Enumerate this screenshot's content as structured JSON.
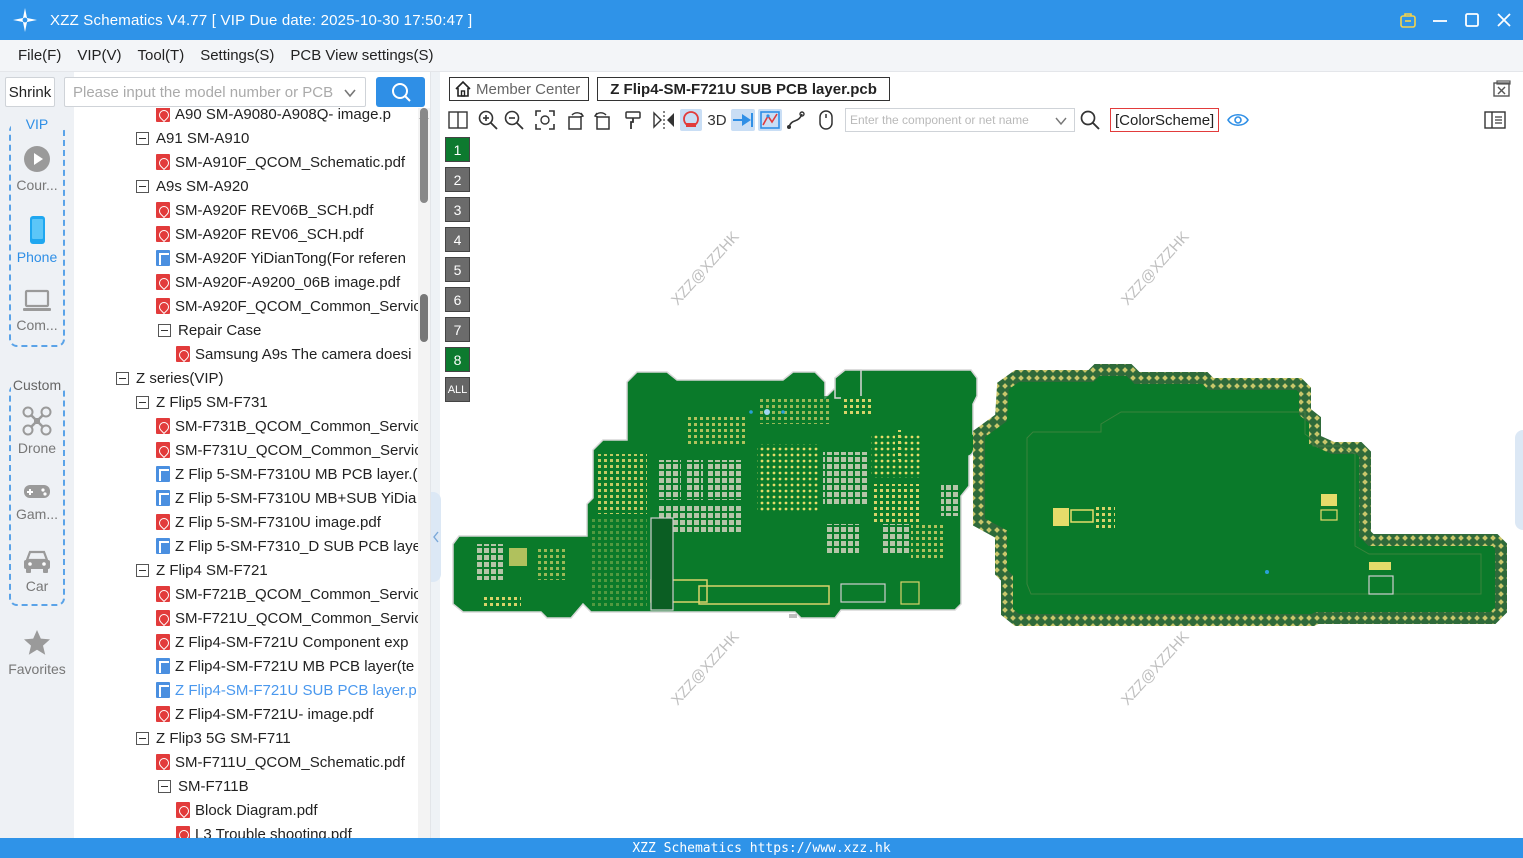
{
  "window": {
    "title": "XZZ Schematics V4.77 [ VIP Due date: 2025-10-30 17:50:47 ]"
  },
  "menu": [
    "File(F)",
    "VIP(V)",
    "Tool(T)",
    "Settings(S)",
    "PCB View settings(S)"
  ],
  "rail": {
    "shrink_label": "Shrink",
    "vip_label": "VIP",
    "vip_items": [
      {
        "label": "Cour...",
        "icon": "play-circle-icon"
      },
      {
        "label": "Phone",
        "icon": "phone-icon"
      },
      {
        "label": "Com...",
        "icon": "laptop-icon"
      }
    ],
    "custom_label": "Custom",
    "custom_items": [
      {
        "label": "Drone",
        "icon": "drone-icon"
      },
      {
        "label": "Gam...",
        "icon": "gamepad-icon"
      },
      {
        "label": "Car",
        "icon": "car-icon"
      }
    ],
    "favorites_label": "Favorites"
  },
  "search": {
    "placeholder": "Please input the model number or PCB"
  },
  "tree": [
    {
      "level": 2,
      "type": "pdf",
      "label": "A90 SM-A9080-A908Q- image.p"
    },
    {
      "level": 1,
      "type": "folder",
      "label": "A91 SM-A910"
    },
    {
      "level": 2,
      "type": "pdf",
      "label": "SM-A910F_QCOM_Schematic.pdf"
    },
    {
      "level": 1,
      "type": "folder",
      "label": "A9s SM-A920"
    },
    {
      "level": 2,
      "type": "pdf",
      "label": "SM-A920F REV06B_SCH.pdf"
    },
    {
      "level": 2,
      "type": "pdf",
      "label": "SM-A920F REV06_SCH.pdf"
    },
    {
      "level": 2,
      "type": "pcb",
      "label": "SM-A920F YiDianTong(For referen"
    },
    {
      "level": 2,
      "type": "pdf",
      "label": "SM-A920F-A9200_06B image.pdf"
    },
    {
      "level": 2,
      "type": "pdf",
      "label": "SM-A920F_QCOM_Common_Servic"
    },
    {
      "level": 2,
      "type": "folder",
      "label": "Repair Case"
    },
    {
      "level": 3,
      "type": "pdf",
      "label": "Samsung A9s The camera doesi"
    },
    {
      "level": 0,
      "type": "folder",
      "label": "Z series(VIP)"
    },
    {
      "level": 1,
      "type": "folder",
      "label": "Z Flip5 SM-F731"
    },
    {
      "level": 2,
      "type": "pdf",
      "label": "SM-F731B_QCOM_Common_Servic"
    },
    {
      "level": 2,
      "type": "pdf",
      "label": "SM-F731U_QCOM_Common_Servic"
    },
    {
      "level": 2,
      "type": "pcb",
      "label": "Z Flip 5-SM-F7310U MB PCB layer.("
    },
    {
      "level": 2,
      "type": "pcb",
      "label": "Z Flip 5-SM-F7310U MB+SUB YiDia"
    },
    {
      "level": 2,
      "type": "pdf",
      "label": "Z Flip 5-SM-F7310U image.pdf"
    },
    {
      "level": 2,
      "type": "pcb",
      "label": "Z Flip 5-SM-F7310_D SUB PCB laye"
    },
    {
      "level": 1,
      "type": "folder",
      "label": "Z Flip4 SM-F721"
    },
    {
      "level": 2,
      "type": "pdf",
      "label": "SM-F721B_QCOM_Common_Servic"
    },
    {
      "level": 2,
      "type": "pdf",
      "label": "SM-F721U_QCOM_Common_Servic"
    },
    {
      "level": 2,
      "type": "pdf",
      "label": "Z Flip4-SM-F721U Component exp"
    },
    {
      "level": 2,
      "type": "pcb",
      "label": "Z Flip4-SM-F721U MB PCB layer(te"
    },
    {
      "level": 2,
      "type": "pcb",
      "label": "Z Flip4-SM-F721U SUB PCB layer.p",
      "selected": true
    },
    {
      "level": 2,
      "type": "pdf",
      "label": "Z Flip4-SM-F721U- image.pdf"
    },
    {
      "level": 1,
      "type": "folder",
      "label": "Z Flip3 5G SM-F711"
    },
    {
      "level": 2,
      "type": "pdf",
      "label": "SM-F711U_QCOM_Schematic.pdf"
    },
    {
      "level": 2,
      "type": "folder",
      "label": "SM-F711B"
    },
    {
      "level": 3,
      "type": "pdf",
      "label": "Block Diagram.pdf"
    },
    {
      "level": 3,
      "type": "pdf",
      "label": "L3 Trouble shooting.pdf"
    }
  ],
  "tabs": {
    "member_center": "Member Center",
    "active_file": "Z Flip4-SM-F721U SUB PCB layer.pcb"
  },
  "toolbar": {
    "three_d_label": "3D",
    "component_placeholder": "Enter the component or net name",
    "color_scheme_label": "[ColorScheme]"
  },
  "layers": [
    "1",
    "2",
    "3",
    "4",
    "5",
    "6",
    "7",
    "8",
    "ALL"
  ],
  "watermark_text": "XZZ@XZZHK",
  "status_bar": "XZZ Schematics https://www.xzz.hk",
  "colors": {
    "accent": "#2f93e8",
    "pcb_green": "#0a7a2a",
    "pcb_pad": "#e8e070",
    "layer_active": "#0d7a2f"
  }
}
